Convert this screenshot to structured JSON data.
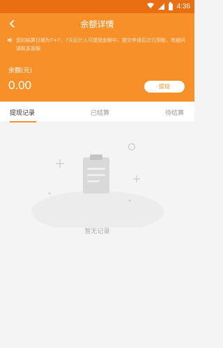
{
  "status_bar": {
    "time": "4:36"
  },
  "header": {
    "title": "余额详情",
    "notice": "您的结算日期为T+7，7天后计入可提现金额中，提交申请后次日到账，有疑问请联系客服",
    "balance_label": "余额(元)",
    "balance_value": "0.00",
    "withdraw_label": "提现"
  },
  "tabs": [
    {
      "label": "提现记录",
      "active": true
    },
    {
      "label": "已结算",
      "active": false
    },
    {
      "label": "待结算",
      "active": false
    }
  ],
  "empty_state": {
    "text": "暂无记录"
  },
  "colors": {
    "accent": "#f8902a",
    "status_bar": "#e96f12"
  }
}
